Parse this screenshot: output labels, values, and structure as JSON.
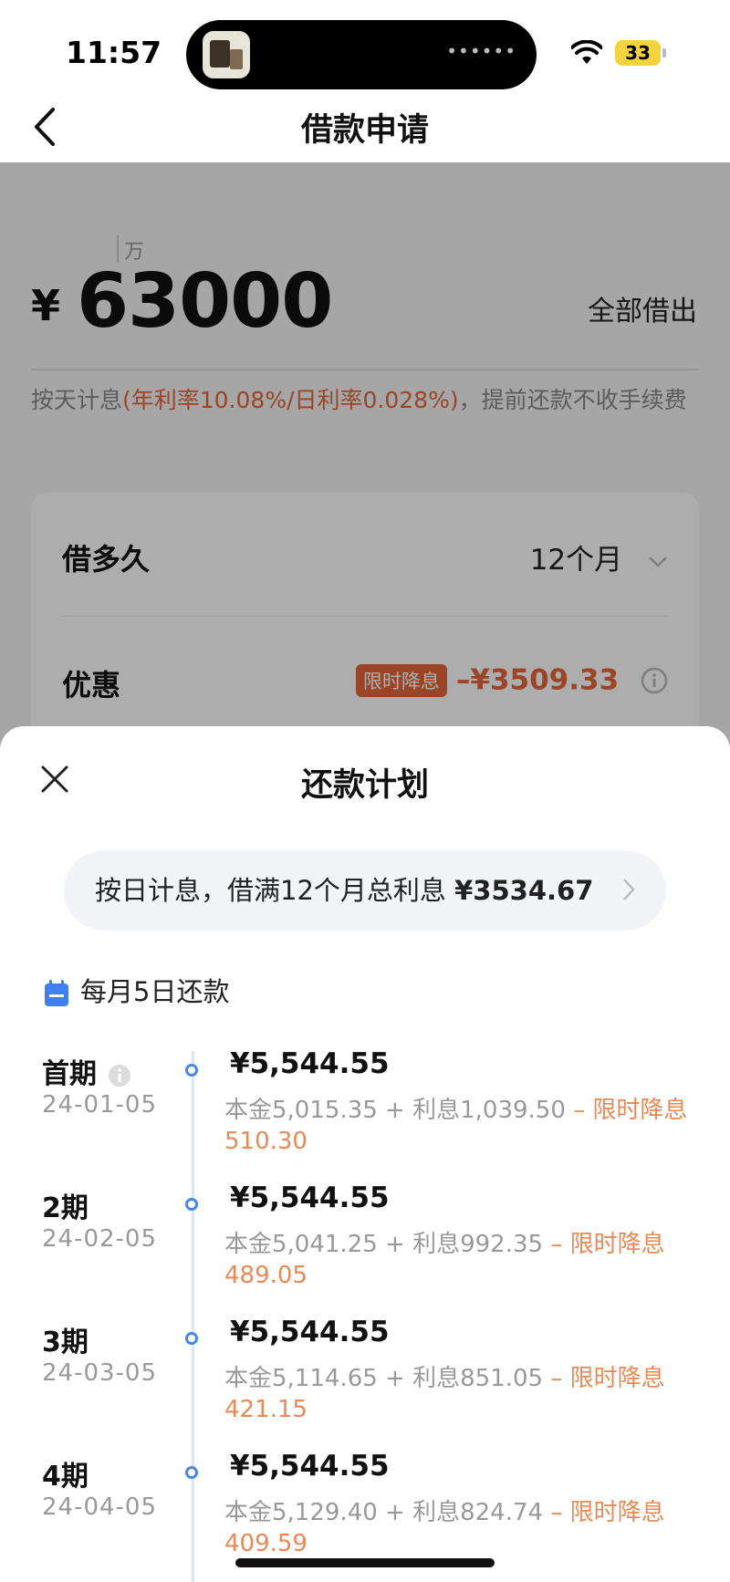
{
  "status_bar": {
    "time": "11:57",
    "battery": "33"
  },
  "nav": {
    "title": "借款申请"
  },
  "loan": {
    "unit": "万",
    "currency": "¥",
    "amount": "63000",
    "borrow_all": "全部借出",
    "rate_prefix": "按天计息",
    "rate_highlight": "(年利率10.08%/日利率0.028%)",
    "rate_suffix": "，提前还款不收手续费"
  },
  "options": {
    "term_label": "借多久",
    "term_value": "12个月",
    "discount_label": "优惠",
    "discount_tag": "限时降息",
    "discount_value": "–¥3509.33"
  },
  "sheet": {
    "title": "还款计划",
    "summary_prefix": "按日计息，借满12个月总利息 ",
    "summary_total": "¥3534.67",
    "repay_day": "每月5日还款",
    "plan": [
      {
        "period": "首期",
        "date": "24-01-05",
        "amount": "¥5,544.55",
        "breakdown": "本金5,015.35 + 利息1,039.50 ",
        "discount": " – 限时降息510.30",
        "has_info": true
      },
      {
        "period": "2期",
        "date": "24-02-05",
        "amount": "¥5,544.55",
        "breakdown": "本金5,041.25 + 利息992.35 ",
        "discount": " – 限时降息489.05",
        "has_info": false
      },
      {
        "period": "3期",
        "date": "24-03-05",
        "amount": "¥5,544.55",
        "breakdown": "本金5,114.65 + 利息851.05 ",
        "discount": " – 限时降息421.15",
        "has_info": false
      },
      {
        "period": "4期",
        "date": "24-04-05",
        "amount": "¥5,544.55",
        "breakdown": "本金5,129.40 + 利息824.74 ",
        "discount": " – 限时降息409.59",
        "has_info": false
      }
    ]
  },
  "colors": {
    "accent": "#e4663a",
    "discount_text": "#e88a55",
    "timeline": "#4a84f0",
    "calendar": "#3f7ff0"
  }
}
